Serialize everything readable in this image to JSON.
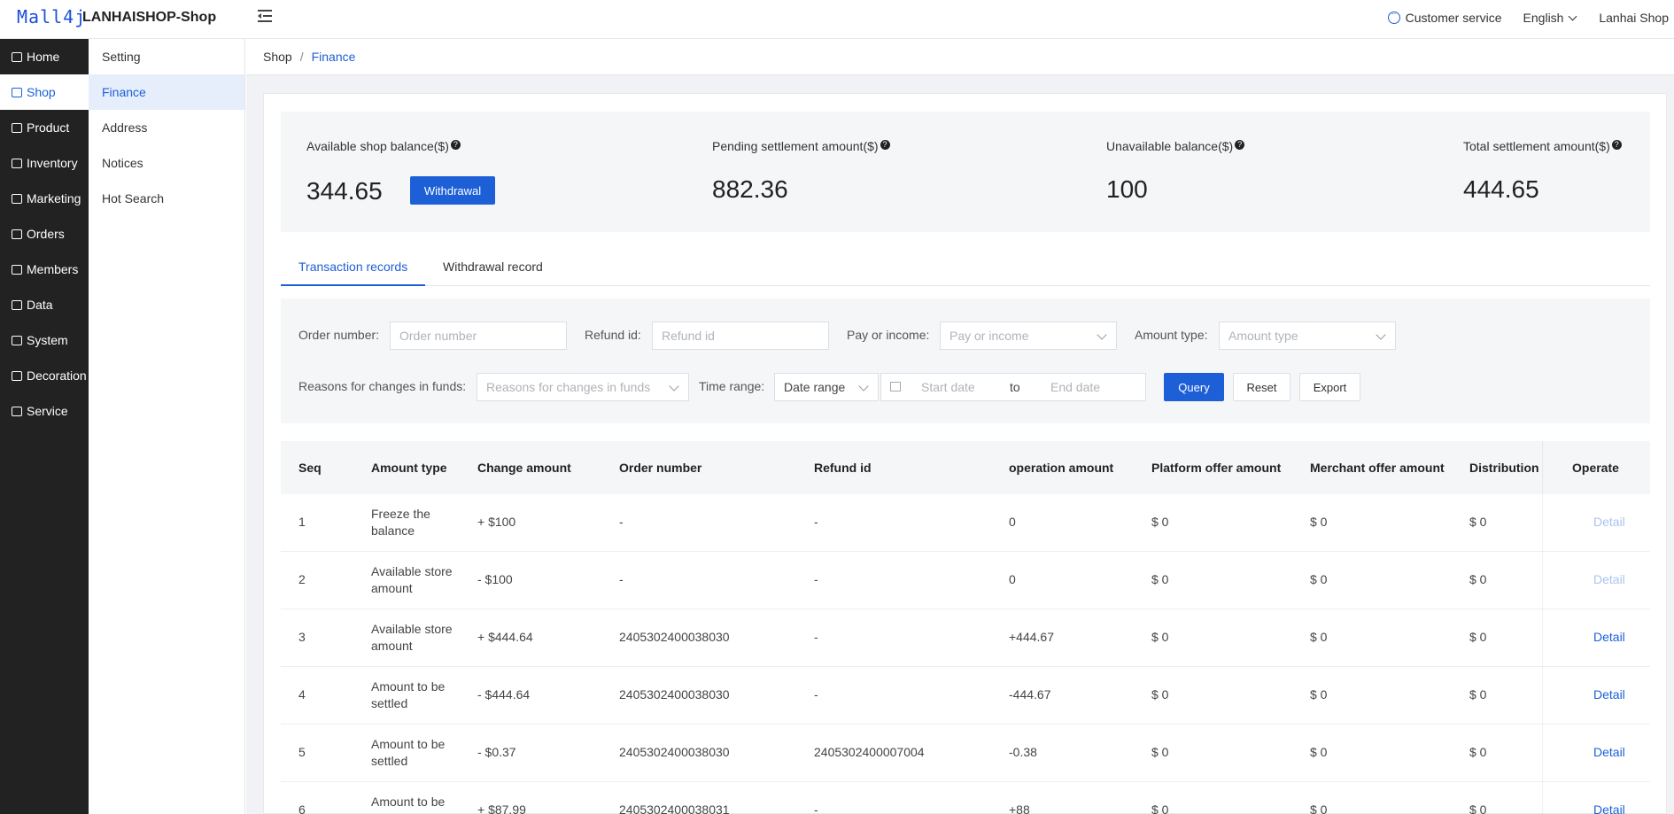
{
  "header": {
    "logo": "Mall4j",
    "shop_name": "LANHAISHOP-Shop",
    "customer_service": "Customer service",
    "language": "English",
    "user": "Lanhai Shop"
  },
  "sidebar": {
    "items": [
      {
        "label": "Home",
        "icon": "home-icon"
      },
      {
        "label": "Shop",
        "icon": "shop-icon"
      },
      {
        "label": "Product",
        "icon": "product-icon"
      },
      {
        "label": "Inventory",
        "icon": "inventory-icon"
      },
      {
        "label": "Marketing",
        "icon": "marketing-icon"
      },
      {
        "label": "Orders",
        "icon": "orders-icon"
      },
      {
        "label": "Members",
        "icon": "members-icon"
      },
      {
        "label": "Data",
        "icon": "data-icon"
      },
      {
        "label": "System",
        "icon": "system-icon"
      },
      {
        "label": "Decoration",
        "icon": "decoration-icon"
      },
      {
        "label": "Service",
        "icon": "service-icon"
      }
    ],
    "active": "Shop"
  },
  "subnav": {
    "items": [
      "Setting",
      "Finance",
      "Address",
      "Notices",
      "Hot Search"
    ],
    "active": "Finance"
  },
  "breadcrumb": {
    "root": "Shop",
    "separator": "/",
    "current": "Finance"
  },
  "summary": {
    "available_label": "Available shop balance($)",
    "available_value": "344.65",
    "withdraw_button": "Withdrawal",
    "pending_label": "Pending settlement amount($)",
    "pending_value": "882.36",
    "unavailable_label": "Unavailable balance($)",
    "unavailable_value": "100",
    "total_label": "Total settlement amount($)",
    "total_value": "444.65"
  },
  "tabs": [
    "Transaction records",
    "Withdrawal record"
  ],
  "filters": {
    "order_number_label": "Order number:",
    "order_number_placeholder": "Order number",
    "refund_id_label": "Refund id:",
    "refund_id_placeholder": "Refund id",
    "pay_income_label": "Pay or income:",
    "pay_income_placeholder": "Pay or income",
    "amount_type_label": "Amount type:",
    "amount_type_placeholder": "Amount type",
    "reasons_label": "Reasons for changes in funds:",
    "reasons_placeholder": "Reasons for changes in funds",
    "time_range_label": "Time range:",
    "time_range_value": "Date range",
    "start_placeholder": "Start date",
    "to": "to",
    "end_placeholder": "End date",
    "query": "Query",
    "reset": "Reset",
    "export": "Export"
  },
  "table": {
    "columns": [
      "Seq",
      "Amount type",
      "Change amount",
      "Order number",
      "Refund id",
      "operation amount",
      "Platform offer amount",
      "Merchant offer amount",
      "Distribution",
      "Operate"
    ],
    "rows": [
      {
        "seq": "1",
        "amount_type": "Freeze the balance",
        "change": "+ $100",
        "order": "-",
        "refund": "-",
        "operation": "0",
        "platform": "$ 0",
        "merchant": "$ 0",
        "distribution": "$ 0",
        "operate": "Detail",
        "disabled": true
      },
      {
        "seq": "2",
        "amount_type": "Available store amount",
        "change": "- $100",
        "order": "-",
        "refund": "-",
        "operation": "0",
        "platform": "$ 0",
        "merchant": "$ 0",
        "distribution": "$ 0",
        "operate": "Detail",
        "disabled": true
      },
      {
        "seq": "3",
        "amount_type": "Available store amount",
        "change": "+ $444.64",
        "order": "2405302400038030",
        "refund": "-",
        "operation": "+444.67",
        "platform": "$ 0",
        "merchant": "$ 0",
        "distribution": "$ 0",
        "operate": "Detail",
        "disabled": false
      },
      {
        "seq": "4",
        "amount_type": "Amount to be settled",
        "change": "- $444.64",
        "order": "2405302400038030",
        "refund": "-",
        "operation": "-444.67",
        "platform": "$ 0",
        "merchant": "$ 0",
        "distribution": "$ 0",
        "operate": "Detail",
        "disabled": false
      },
      {
        "seq": "5",
        "amount_type": "Amount to be settled",
        "change": "- $0.37",
        "order": "2405302400038030",
        "refund": "2405302400007004",
        "operation": "-0.38",
        "platform": "$ 0",
        "merchant": "$ 0",
        "distribution": "$ 0",
        "operate": "Detail",
        "disabled": false
      },
      {
        "seq": "6",
        "amount_type": "Amount to be settled",
        "change": "+ $87.99",
        "order": "2405302400038031",
        "refund": "-",
        "operation": "+88",
        "platform": "$ 0",
        "merchant": "$ 0",
        "distribution": "$ 0",
        "operate": "Detail",
        "disabled": false
      }
    ]
  },
  "colors": {
    "accent": "#1d5fd6",
    "sidebar_bg": "#222222",
    "disabled_link": "#a9c4ee"
  }
}
